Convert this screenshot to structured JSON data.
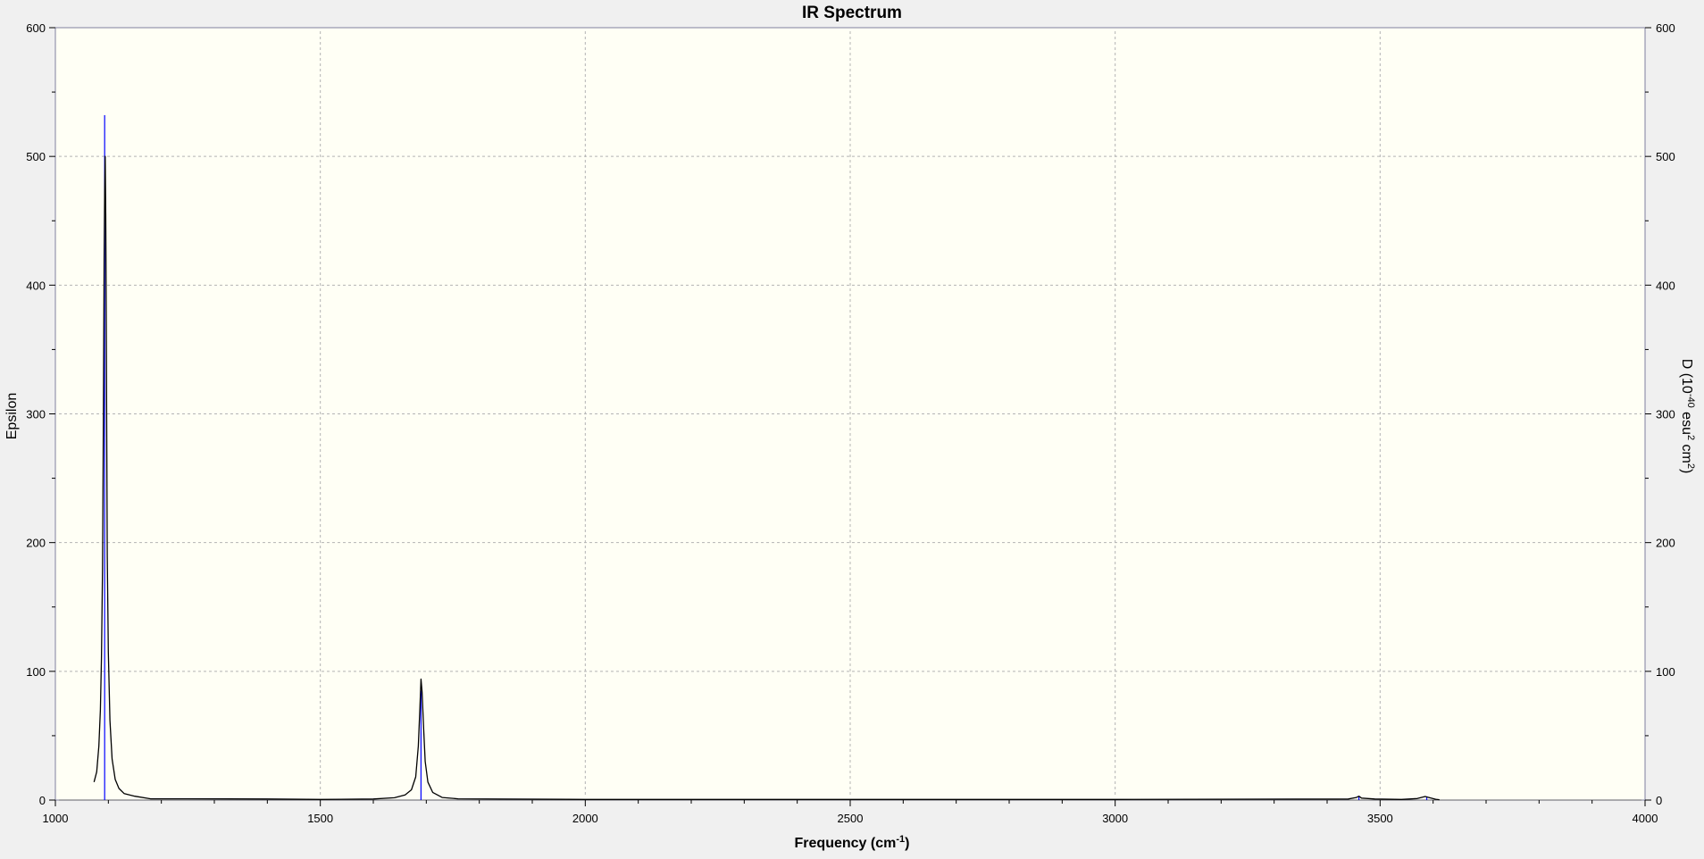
{
  "chart_data": {
    "type": "line",
    "title": "IR Spectrum",
    "xlabel": "Frequency (cm",
    "xlabel_sup": "-1",
    "xlabel_end": ")",
    "ylabel": "Epsilon",
    "y2label": {
      "p1": "D (10",
      "sup1": "-40",
      "p2": " esu",
      "sup2": "2",
      "p3": " cm",
      "sup3": "2",
      "p4": ")"
    },
    "xlim": [
      1000,
      4000
    ],
    "ylim": [
      0,
      600
    ],
    "y2lim": [
      0,
      600
    ],
    "x_ticks": [
      1000,
      1500,
      2000,
      2500,
      3000,
      3500,
      4000
    ],
    "y_ticks": [
      0,
      100,
      200,
      300,
      400,
      500,
      600
    ],
    "y2_ticks": [
      0,
      100,
      200,
      300,
      400,
      500,
      600
    ],
    "grid": true,
    "colors": {
      "plot_bg": "#fffff5",
      "spectrum": "#000000",
      "sticks": "#0000ff",
      "grid": "#b4b4b4"
    },
    "series": [
      {
        "values": [
          [
            1073,
            14
          ],
          [
            1078,
            22
          ],
          [
            1082,
            42
          ],
          [
            1085,
            70
          ],
          [
            1087,
            110
          ],
          [
            1089,
            180
          ],
          [
            1090,
            250
          ],
          [
            1091,
            330
          ],
          [
            1092,
            420
          ],
          [
            1093,
            472
          ],
          [
            1094,
            500
          ],
          [
            1095,
            455
          ],
          [
            1096,
            370
          ],
          [
            1097,
            270
          ],
          [
            1098,
            190
          ],
          [
            1100,
            115
          ],
          [
            1103,
            62
          ],
          [
            1107,
            32
          ],
          [
            1113,
            16
          ],
          [
            1120,
            9
          ],
          [
            1130,
            5
          ],
          [
            1150,
            3
          ],
          [
            1180,
            1
          ],
          [
            1250,
            1
          ],
          [
            1400,
            0.8
          ],
          [
            1500,
            0.5
          ],
          [
            1600,
            0.8
          ],
          [
            1640,
            1.8
          ],
          [
            1660,
            4
          ],
          [
            1672,
            8
          ],
          [
            1680,
            18
          ],
          [
            1685,
            42
          ],
          [
            1688,
            72
          ],
          [
            1690,
            94
          ],
          [
            1692,
            84
          ],
          [
            1695,
            55
          ],
          [
            1698,
            30
          ],
          [
            1703,
            14
          ],
          [
            1712,
            6
          ],
          [
            1730,
            2
          ],
          [
            1760,
            1
          ],
          [
            2000,
            0.5
          ],
          [
            2500,
            0.5
          ],
          [
            3000,
            0.5
          ],
          [
            3440,
            0.8
          ],
          [
            3455,
            2
          ],
          [
            3460,
            3
          ],
          [
            3465,
            1.5
          ],
          [
            3490,
            0.8
          ],
          [
            3540,
            0.5
          ],
          [
            3570,
            1.2
          ],
          [
            3585,
            2.8
          ],
          [
            3592,
            2
          ],
          [
            3605,
            0.6
          ],
          [
            3612,
            0.3
          ]
        ]
      }
    ],
    "sticks": [
      [
        1093,
        532
      ],
      [
        1690,
        85
      ],
      [
        3460,
        3
      ],
      [
        3588,
        2
      ]
    ]
  }
}
